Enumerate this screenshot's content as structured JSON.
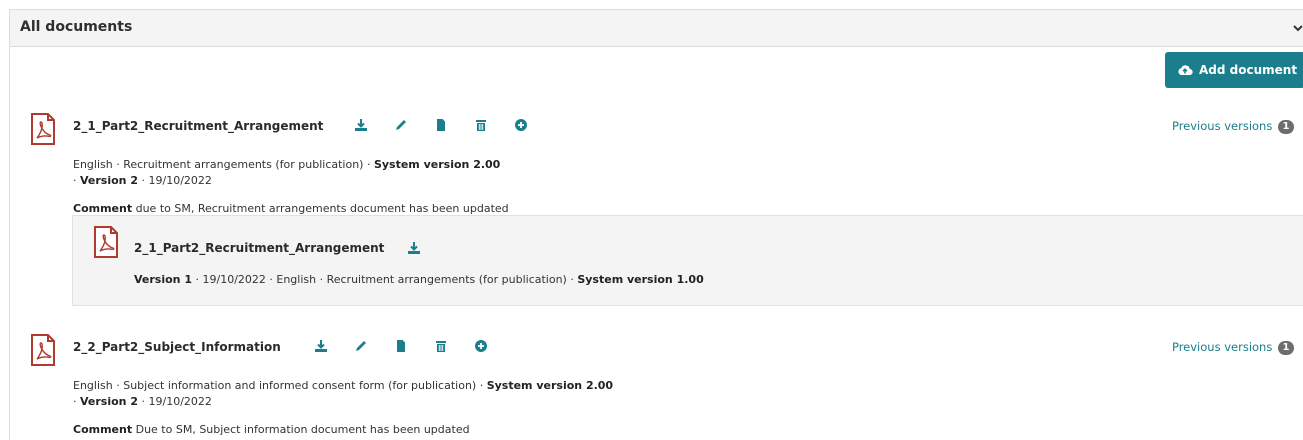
{
  "panel": {
    "title": "All documents"
  },
  "add_button": {
    "label": "Add document"
  },
  "documents": [
    {
      "title": "2_1_Part2_Recruitment_Arrangement",
      "prev_versions_label": "Previous versions",
      "prev_versions_count": "1",
      "meta_prefix": "English · Recruitment arrangements (for publication) · ",
      "system_version": "System version 2.00",
      "meta_sep": "· ",
      "version": "Version 2",
      "date": " · 19/10/2022",
      "comment_label": "Comment",
      "comment_text": " due to SM, Recruitment arrangements document has been updated",
      "previous": {
        "title": "2_1_Part2_Recruitment_Arrangement",
        "version": "Version 1",
        "meta": " · 19/10/2022 · English · Recruitment arrangements (for publication) · ",
        "system_version": "System version 1.00"
      }
    },
    {
      "title": "2_2_Part2_Subject_Information",
      "prev_versions_label": "Previous versions",
      "prev_versions_count": "1",
      "meta_prefix": "English · Subject information and informed consent form (for publication) · ",
      "system_version": "System version 2.00",
      "meta_sep": "· ",
      "version": "Version 2",
      "date": " · 19/10/2022",
      "comment_label": "Comment",
      "comment_text": " Due to SM, Subject information document has been updated"
    }
  ],
  "icons": {
    "pdf": "pdf-file-icon",
    "download": "download-icon",
    "edit": "pencil-icon",
    "file": "file-icon",
    "delete": "trash-icon",
    "add_version": "plus-circle-icon",
    "upload": "cloud-upload-icon",
    "collapse": "chevron-down-icon"
  },
  "colors": {
    "accent": "#1b7e8c",
    "pdf": "#b03a2e",
    "header_bg": "#f4f4f4",
    "badge": "#6d6d6d"
  }
}
